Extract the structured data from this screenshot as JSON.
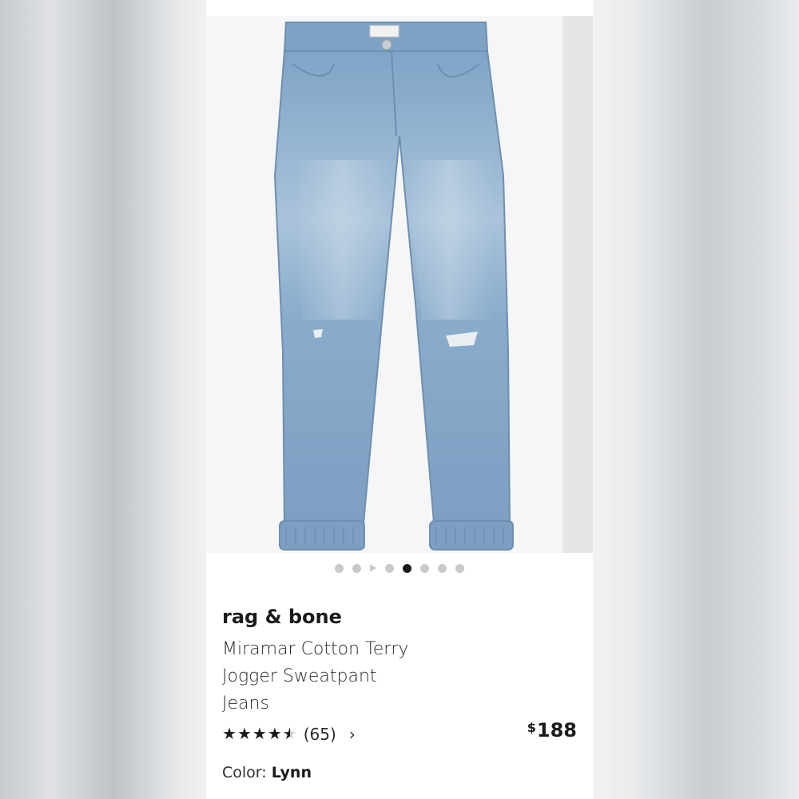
{
  "product": {
    "brand": "rag & bone",
    "name_lines": [
      "Miramar Cotton Terry",
      "Jogger Sweatpant",
      "Jeans"
    ],
    "rating_value": 4.5,
    "rating_max": 5,
    "review_count": "(65)",
    "price_symbol": "$",
    "price_amount": "188",
    "color_label": "Color:",
    "color_value": "Lynn"
  },
  "carousel": {
    "total_items": 8,
    "active_index": 4,
    "video_index": 2
  },
  "icons": {
    "review_link": "chevron-right-icon",
    "video_indicator": "play-icon"
  },
  "colors": {
    "denim": "#8fb2d1",
    "active_dot": "#1a1a1a",
    "inactive_dot": "#c9c9c9"
  }
}
